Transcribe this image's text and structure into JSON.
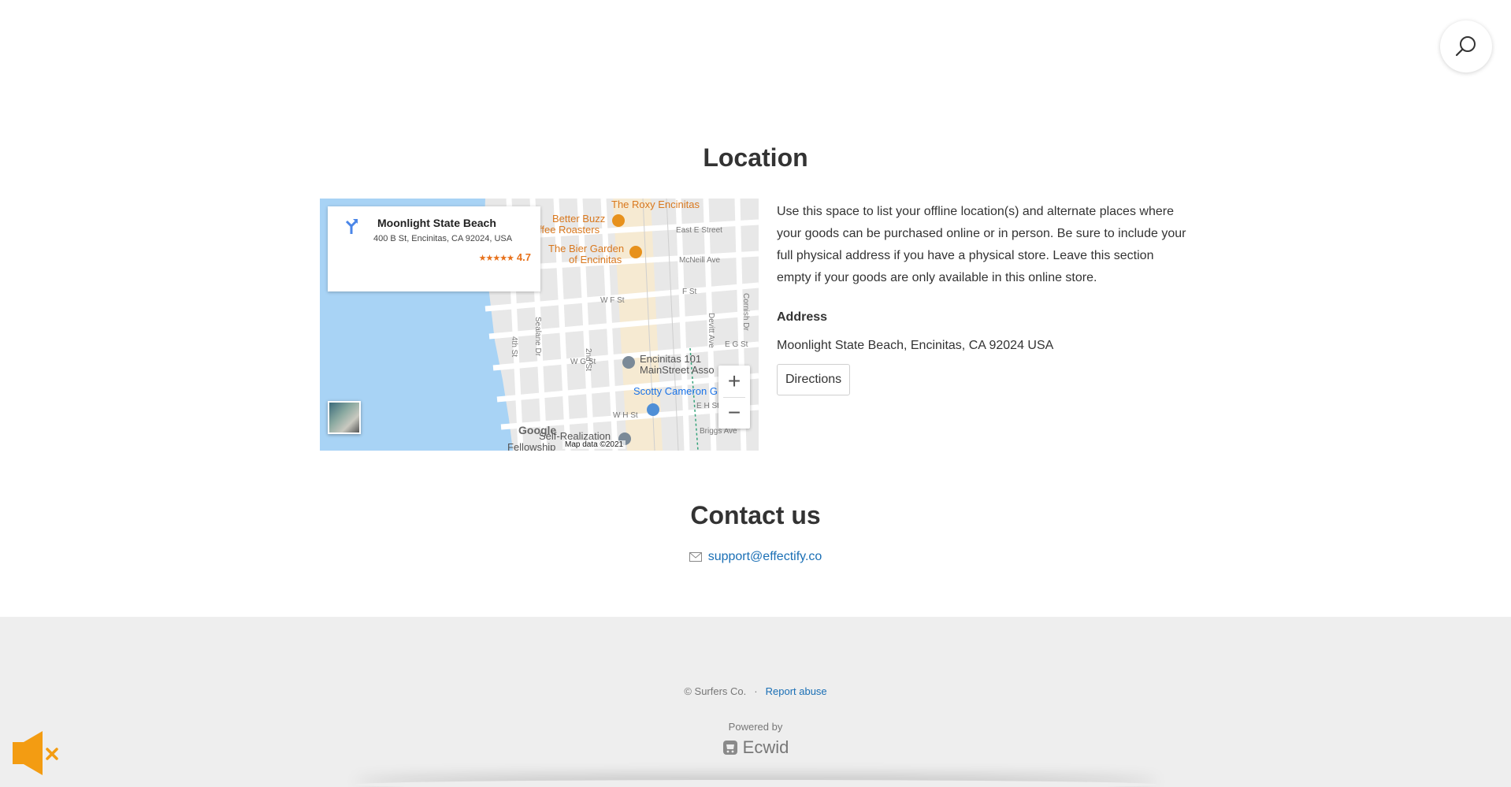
{
  "header": {
    "search_icon": "search-icon"
  },
  "location": {
    "title": "Location",
    "map": {
      "place_name": "Moonlight State Beach",
      "place_address": "400 B St, Encinitas, CA 92024, USA",
      "rating": "4.7",
      "stars": "★★★★★",
      "poi_labels": {
        "roxy": "The Roxy Encinitas",
        "better_buzz_1": "Better Buzz",
        "better_buzz_2": "ffee Roasters",
        "bier_1": "The Bier Garden",
        "bier_2": "of Encinitas",
        "mainstreet_1": "Encinitas 101",
        "mainstreet_2": "MainStreet Asso",
        "scotty": "Scotty Cameron G",
        "self_real_1": "Self-Realization",
        "self_real_2": "Fellowship"
      },
      "street_labels": {
        "east_e": "East E Street",
        "mcneill": "McNeill Ave",
        "f_st": "F St",
        "w_f": "W F St",
        "w_g": "W G St",
        "w_h": "W H St",
        "e_g": "E G St",
        "e_h": "E H St",
        "briggs": "Briggs Ave",
        "fourth": "4th St",
        "seaside": "Sealane Dr",
        "second": "2nd St",
        "devitt": "Devitt Ave",
        "cornish": "Cornish Dr"
      },
      "zoom_in": "+",
      "zoom_out": "−",
      "google_logo": "Google",
      "map_data": "Map data ©2021"
    },
    "description": "Use this space to list your offline location(s) and alternate places where your goods can be purchased online or in person. Be sure to include your full physical address if you have a physical store. Leave this section empty if your goods are only available in this online store.",
    "address_heading": "Address",
    "address": "Moonlight State Beach, Encinitas, CA 92024 USA",
    "directions_label": "Directions"
  },
  "contact": {
    "title": "Contact us",
    "email": "support@effectify.co"
  },
  "footer": {
    "copyright": "© Surfers Co.",
    "separator": "·",
    "report_abuse": "Report abuse",
    "powered_by": "Powered by",
    "brand": "Ecwid"
  },
  "colors": {
    "link": "#1a6fb5",
    "mute_icon": "#f39c12",
    "footer_bg": "#eeeeee",
    "water": "#a8d3f5"
  }
}
